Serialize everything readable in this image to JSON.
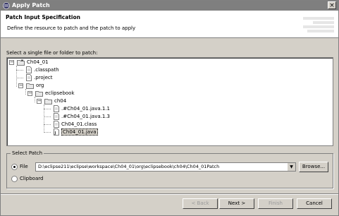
{
  "window": {
    "title": "Apply Patch",
    "close_label": "×"
  },
  "header": {
    "title": "Patch Input Specification",
    "description": "Define the resource to patch and the patch to apply"
  },
  "resource": {
    "label": "Select a single file or folder to patch:",
    "tree": [
      {
        "label": "Ch04_01",
        "icon": "project-folder-icon",
        "expanded": true
      },
      {
        "label": ".classpath",
        "icon": "file-icon"
      },
      {
        "label": ".project",
        "icon": "file-icon"
      },
      {
        "label": "org",
        "icon": "folder-icon",
        "expanded": true
      },
      {
        "label": "eclipsebook",
        "icon": "folder-icon",
        "expanded": true
      },
      {
        "label": "ch04",
        "icon": "folder-icon",
        "expanded": true
      },
      {
        "label": ".#Ch04_01.java.1.1",
        "icon": "file-icon"
      },
      {
        "label": ".#Ch04_01.java.1.3",
        "icon": "file-icon"
      },
      {
        "label": "Ch04_01.class",
        "icon": "file-icon"
      },
      {
        "label": "Ch04_01.java",
        "icon": "java-file-icon",
        "selected": true
      }
    ]
  },
  "patch": {
    "group_title": "Select Patch",
    "file_label": "File",
    "file_selected": true,
    "file_path": "D:\\eclipse211\\eclipse\\workspace\\Ch04_01\\org\\eclipsebook\\ch04\\Ch04_01Patch",
    "browse_label": "Browse...",
    "clipboard_label": "Clipboard",
    "clipboard_selected": false
  },
  "buttons": {
    "back": "< Back",
    "next": "Next >",
    "finish": "Finish",
    "cancel": "Cancel"
  }
}
